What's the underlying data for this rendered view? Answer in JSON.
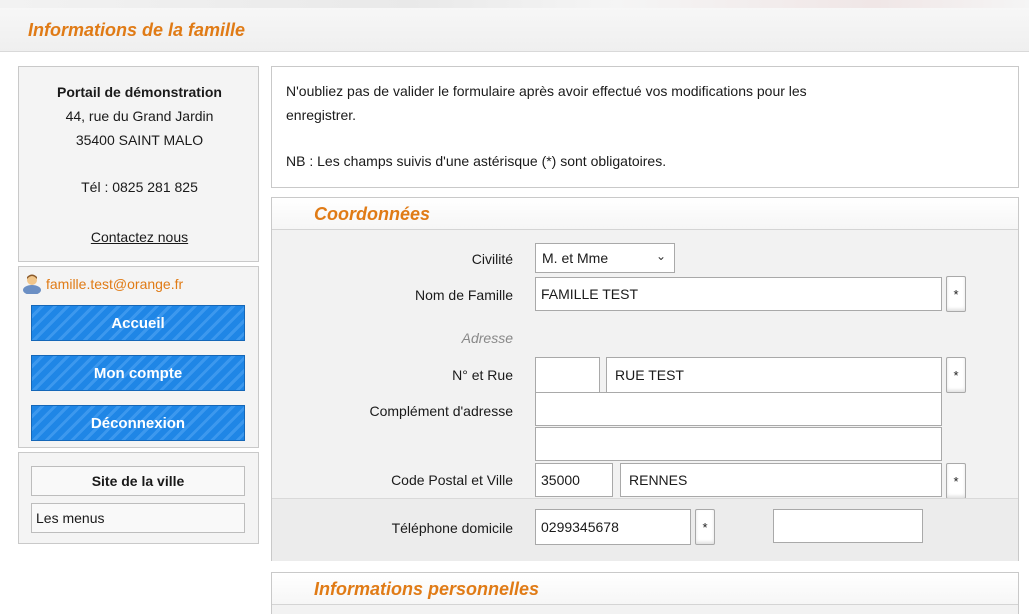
{
  "header": {
    "title": "Informations de la famille"
  },
  "portal": {
    "name": "Portail de démonstration",
    "address_line1": "44, rue du Grand Jardin",
    "address_line2": "35400 SAINT MALO",
    "phone": "Tél : 0825 281 825",
    "contact_link": "Contactez nous"
  },
  "user": {
    "icon": "user-icon",
    "email": "famille.test@orange.fr",
    "nav": [
      {
        "label": "Accueil"
      },
      {
        "label": "Mon compte"
      },
      {
        "label": "Déconnexion"
      }
    ]
  },
  "links": {
    "city_site": "Site de la ville",
    "menus": "Les menus"
  },
  "notice": {
    "line1": "N'oubliez pas de valider le formulaire après avoir effectué vos modifications pour les",
    "line2": "enregistrer.",
    "nb": "NB : Les champs suivis d'une astérisque (*) sont obligatoires."
  },
  "coordonnees": {
    "title": "Coordonnées",
    "civilite": {
      "label": "Civilité",
      "value": "M. et Mme"
    },
    "nom": {
      "label": "Nom de Famille",
      "value": "FAMILLE TEST"
    },
    "adresse_heading": "Adresse",
    "rue": {
      "label": "N° et Rue",
      "number": "",
      "street": "RUE TEST"
    },
    "complement": {
      "label": "Complément d'adresse",
      "line1": "",
      "line2": ""
    },
    "cp_ville": {
      "label": "Code Postal et Ville",
      "postal_code": "35000",
      "city": "RENNES"
    },
    "telephone": {
      "label": "Téléphone domicile",
      "value": "0299345678",
      "extra": ""
    },
    "required_mark": "*"
  },
  "perso": {
    "title": "Informations personnelles"
  },
  "colors": {
    "accent": "#e07b16",
    "nav_blue": "#1f86e6"
  }
}
